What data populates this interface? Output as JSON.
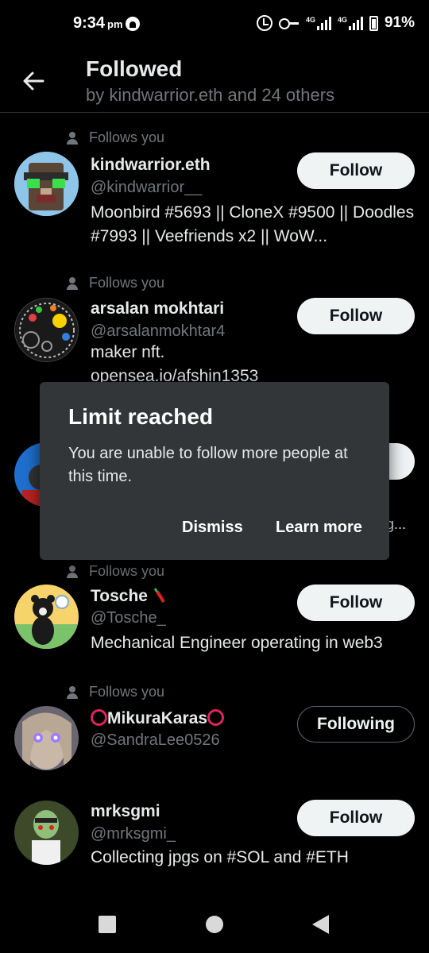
{
  "status_bar": {
    "time": "9:34",
    "ampm": "pm",
    "net1": "4G",
    "net2": "4G",
    "battery": "91%"
  },
  "header": {
    "title": "Followed",
    "subtitle": "by kindwarrior.eth and 24 others",
    "back_icon": "back-arrow-icon"
  },
  "users": [
    {
      "follows_you": "Follows you",
      "name": "kindwarrior.eth",
      "handle": "@kindwarrior__",
      "bio": "Moonbird #5693 || CloneX #9500 || Doodles #7993 || Veefriends x2 || WoW...",
      "button": "Follow"
    },
    {
      "follows_you": "Follows you",
      "name": "arsalan mokhtari",
      "handle": "@arsalanmokhtar4",
      "bio": "maker nft.",
      "bio2": "opensea.io/afshin1353",
      "button": "Follow"
    },
    {
      "bio_tail": "g..."
    },
    {
      "follows_you": "Follows you",
      "name": "Tosche",
      "handle": "@Tosche_",
      "bio": "Mechanical Engineer operating in web3",
      "button": "Follow"
    },
    {
      "follows_you": "Follows you",
      "name": "MikuraKaras",
      "handle": "@SandraLee0526",
      "button": "Following"
    },
    {
      "name": "mrksgmi",
      "handle": "@mrksgmi_",
      "bio": "Collecting jpgs on #SOL and #ETH",
      "button": "Follow"
    }
  ],
  "dialog": {
    "title": "Limit reached",
    "message": "You are unable to follow more people at this time.",
    "dismiss": "Dismiss",
    "learn_more": "Learn more"
  },
  "nav": {
    "recents_icon": "square-icon",
    "home_icon": "circle-icon",
    "back_icon": "triangle-back-icon"
  }
}
